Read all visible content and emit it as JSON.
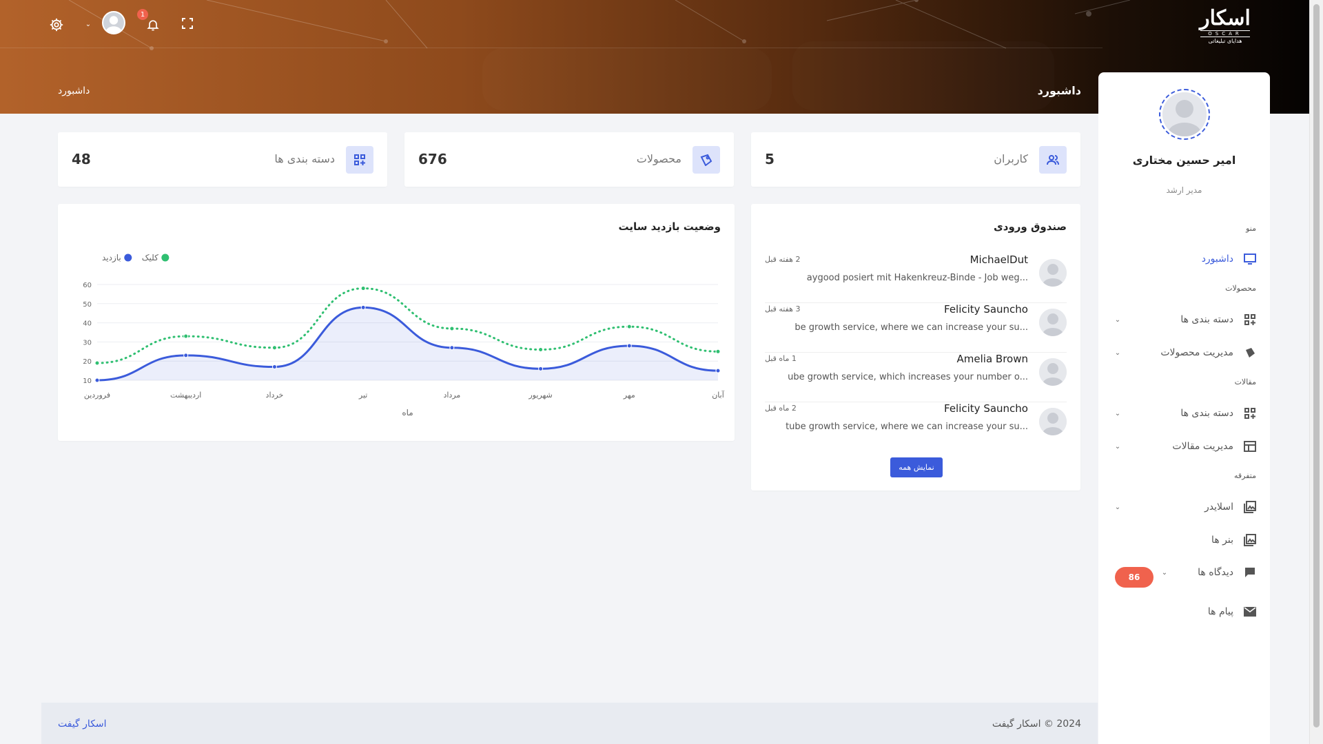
{
  "header": {
    "logo_text": "اسکار",
    "logo_latin": "OSCAR",
    "logo_sub": "هدایای تبلیغاتی",
    "notification_count": "1",
    "page_title": "داشبورد",
    "breadcrumb": "داشبورد"
  },
  "profile": {
    "name": "امیر حسین مختاری",
    "role": "مدیر ارشد"
  },
  "sidebar": {
    "sections": {
      "menu": "منو",
      "products": "محصولات",
      "articles": "مقالات",
      "misc": "متفرقه"
    },
    "items": [
      {
        "label": "داشبورد",
        "icon": "monitor-icon"
      },
      {
        "label": "دسته بندی ها",
        "icon": "grid-plus-icon"
      },
      {
        "label": "مدیریت محصولات",
        "icon": "tag-icon"
      },
      {
        "label": "دسته بندی ها",
        "icon": "grid-plus-icon"
      },
      {
        "label": "مدیریت مقالات",
        "icon": "newspaper-icon"
      },
      {
        "label": "اسلایدر",
        "icon": "image-stack-icon"
      },
      {
        "label": "بنر ها",
        "icon": "image-icon"
      },
      {
        "label": "دیدگاه ها",
        "icon": "comment-icon"
      },
      {
        "label": "پیام ها",
        "icon": "mail-icon"
      }
    ],
    "comments_badge": "86"
  },
  "stats": [
    {
      "label": "کاربران",
      "value": "5",
      "icon": "users-icon"
    },
    {
      "label": "محصولات",
      "value": "676",
      "icon": "tag-icon"
    },
    {
      "label": "دسته بندی ها",
      "value": "48",
      "icon": "grid-plus-icon"
    }
  ],
  "inbox": {
    "title": "صندوق ورودی",
    "show_all": "نمایش همه",
    "messages": [
      {
        "name": "MichaelDut",
        "time": "2 هفته قبل",
        "text": "aygood posiert mit Hakenkreuz-Binde - Job weg..."
      },
      {
        "name": "Felicity Sauncho",
        "time": "3 هفته قبل",
        "text": "be growth service, where we can increase your su..."
      },
      {
        "name": "Amelia Brown",
        "time": "1 ماه قبل",
        "text": "ube growth service, which increases your number o..."
      },
      {
        "name": "Felicity Sauncho",
        "time": "2 ماه قبل",
        "text": "tube growth service, where we can increase your su..."
      }
    ]
  },
  "chart_data": {
    "type": "line",
    "title": "وضعیت بازدید سایت",
    "xlabel": "ماه",
    "ylabel": "",
    "categories": [
      "فروردین",
      "اردیبهشت",
      "خرداد",
      "تیر",
      "مرداد",
      "شهریور",
      "مهر",
      "آبان"
    ],
    "ylim": [
      10,
      60
    ],
    "yticks": [
      10,
      20,
      30,
      40,
      50,
      60
    ],
    "legend": "top-left",
    "series": [
      {
        "name": "بازدید",
        "color": "#3b5bdb",
        "style": "solid",
        "fill": true,
        "values": [
          10,
          23,
          17,
          48,
          27,
          16,
          28,
          15
        ]
      },
      {
        "name": "کلیک",
        "color": "#2fbf71",
        "style": "dotted",
        "fill": false,
        "values": [
          19,
          33,
          27,
          58,
          37,
          26,
          38,
          25
        ]
      }
    ]
  },
  "footer": {
    "copyright": "2024 © اسکار گیفت",
    "brand_link": "اسکار گیفت"
  }
}
